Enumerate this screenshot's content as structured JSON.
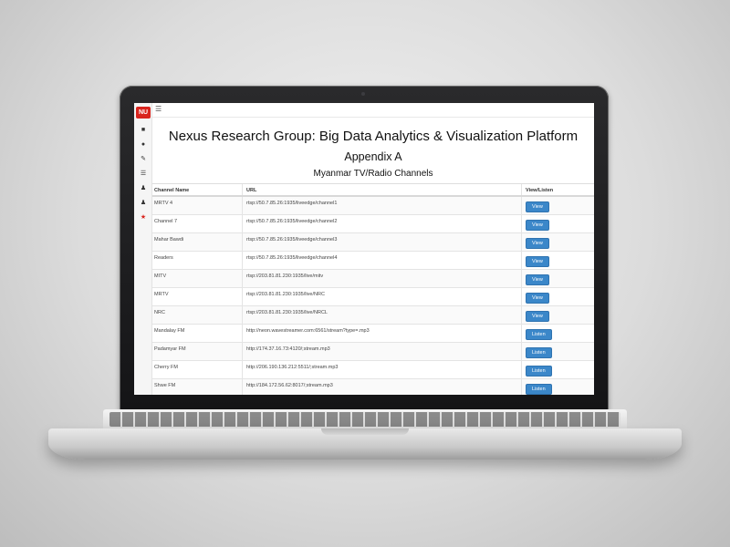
{
  "app": {
    "logo_text": "NU",
    "title": "Nexus Research Group: Big Data Analytics & Visualization Platform",
    "subtitle": "Appendix A",
    "section": "Myanmar TV/Radio Channels"
  },
  "sidebar": {
    "icons": [
      "dashboard-icon",
      "pie-chart-icon",
      "edit-icon",
      "list-icon",
      "users-icon",
      "user-plus-icon",
      "pin-icon"
    ]
  },
  "colors": {
    "accent": "#3b87c9",
    "logo": "#d9241d"
  },
  "table": {
    "headers": {
      "name": "Channel Name",
      "url": "URL",
      "action": "View/Listen"
    },
    "rows": [
      {
        "name": "MRTV 4",
        "url": "rtsp://50.7.85.26:1935/liveedge/channel1",
        "action": "View"
      },
      {
        "name": "Channel 7",
        "url": "rtsp://50.7.85.26:1935/liveedge/channel2",
        "action": "View"
      },
      {
        "name": "Mahar Bawdi",
        "url": "rtsp://50.7.85.26:1935/liveedge/channel3",
        "action": "View"
      },
      {
        "name": "Readers",
        "url": "rtsp://50.7.85.26:1935/liveedge/channel4",
        "action": "View"
      },
      {
        "name": "MITV",
        "url": "rtsp://203.81.81.230:1935/live/mitv",
        "action": "View"
      },
      {
        "name": "MRTV",
        "url": "rtsp://203.81.81.230:1935/live/NRC",
        "action": "View"
      },
      {
        "name": "NRC",
        "url": "rtsp://203.81.81.230:1935/live/NRCL",
        "action": "View"
      },
      {
        "name": "Mandalay FM",
        "url": "http://neon.wavestreamer.com:6561/stream?type=.mp3",
        "action": "Listen"
      },
      {
        "name": "Padamyar FM",
        "url": "http://174.37.16.73:4120/;stream.mp3",
        "action": "Listen"
      },
      {
        "name": "Cherry FM",
        "url": "http://206.190.136.212:5511/;stream.mp3",
        "action": "Listen"
      },
      {
        "name": "Shwe FM",
        "url": "http://184.172.56.62:8017/;stream.mp3",
        "action": "Listen"
      }
    ]
  }
}
